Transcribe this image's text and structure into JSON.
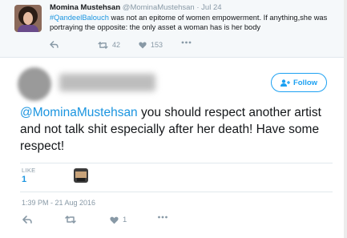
{
  "parent_tweet": {
    "name": "Momina Mustehsan",
    "handle": "@MominaMustehsan",
    "separator": "·",
    "date": "Jul 24",
    "hashtag": "#QandeelBalouch",
    "text": " was not an epitome of women empowerment. If anything,she was portraying the opposite: the only asset a woman has is her body",
    "retweet_count": "42",
    "like_count": "153"
  },
  "main_tweet": {
    "follow_label": "Follow",
    "mention": "@MominaMustehsan",
    "text": " you should respect another artist and not talk shit especially after her death! Have some respect!",
    "likes_label": "LIKE",
    "likes_count": "1",
    "timestamp": "1:39 PM - 21 Aug 2016",
    "like_action_count": "1"
  },
  "colors": {
    "accent": "#1da1f2",
    "link": "#1b95e0",
    "muted": "#8899a6",
    "text": "#14171a"
  },
  "icons": [
    "reply-icon",
    "retweet-icon",
    "heart-icon",
    "more-icon",
    "add-user-icon"
  ]
}
